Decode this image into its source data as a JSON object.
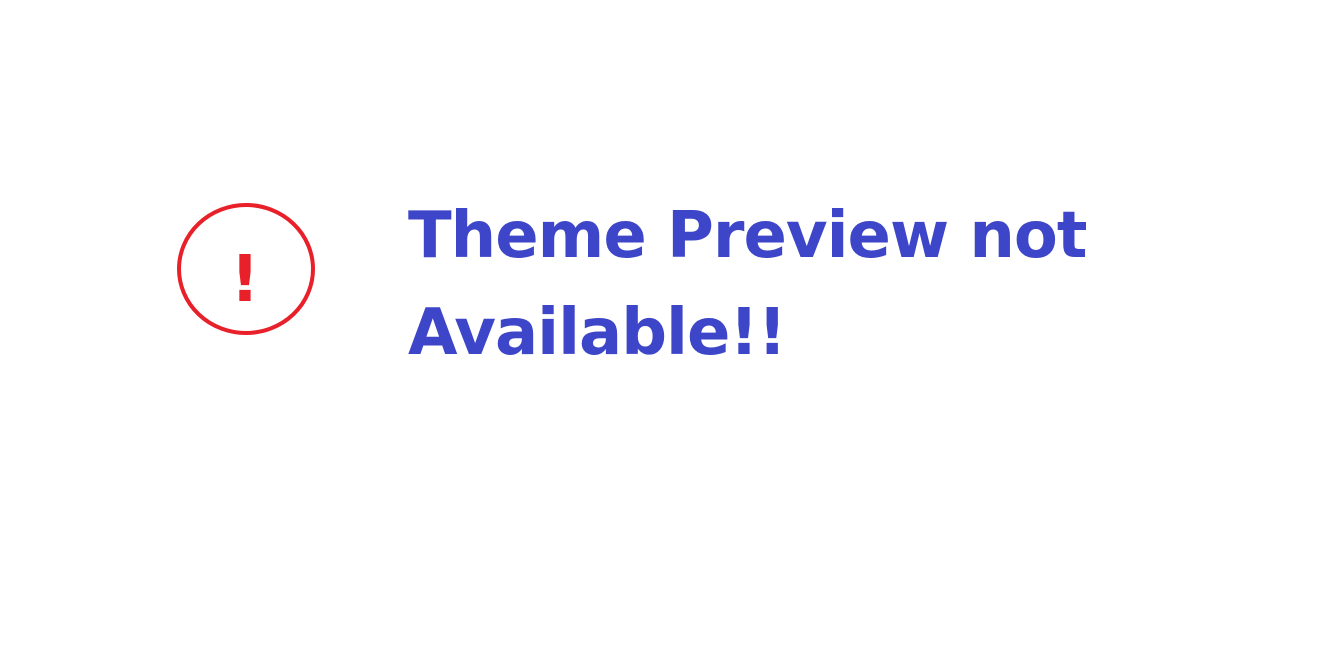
{
  "notice": {
    "icon": "exclamation-circle-icon",
    "icon_glyph": "!",
    "icon_color": "#e8202a",
    "message_line_1": "Theme Preview not",
    "message_line_2": "Available!!",
    "message_color": "#3d45c8"
  }
}
